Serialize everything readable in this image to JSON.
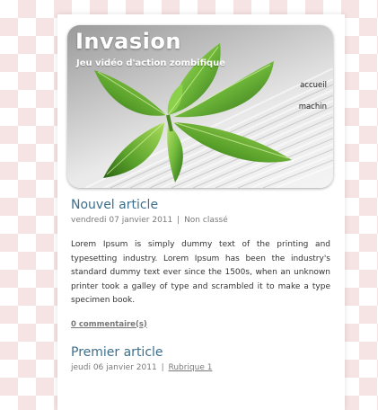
{
  "header": {
    "title": "Invasion",
    "tagline": "Jeu vidéo d'action zombifique",
    "nav": [
      {
        "label": "accueil"
      },
      {
        "label": "machin"
      }
    ]
  },
  "posts": [
    {
      "title": "Nouvel article",
      "date": "vendredi 07 janvier 2011",
      "separator": "|",
      "category": "Non classé",
      "body": "Lorem Ipsum is simply dummy text of the printing and typesetting industry. Lorem Ipsum has been the industry's standard dummy text ever since the 1500s, when an unknown printer took a galley of type and scrambled it to make a type specimen book.",
      "comments": "0 commentaire(s)"
    },
    {
      "title": "Premier article",
      "date": "jeudi 06 janvier 2011",
      "separator": "|",
      "category": "Rubrique 1"
    }
  ],
  "colors": {
    "title_link": "#3d6f8c",
    "background_check": "#f6e3e3",
    "leaf_green": "#5a9a2a"
  },
  "icons": [
    "basil-leaf-photo"
  ]
}
